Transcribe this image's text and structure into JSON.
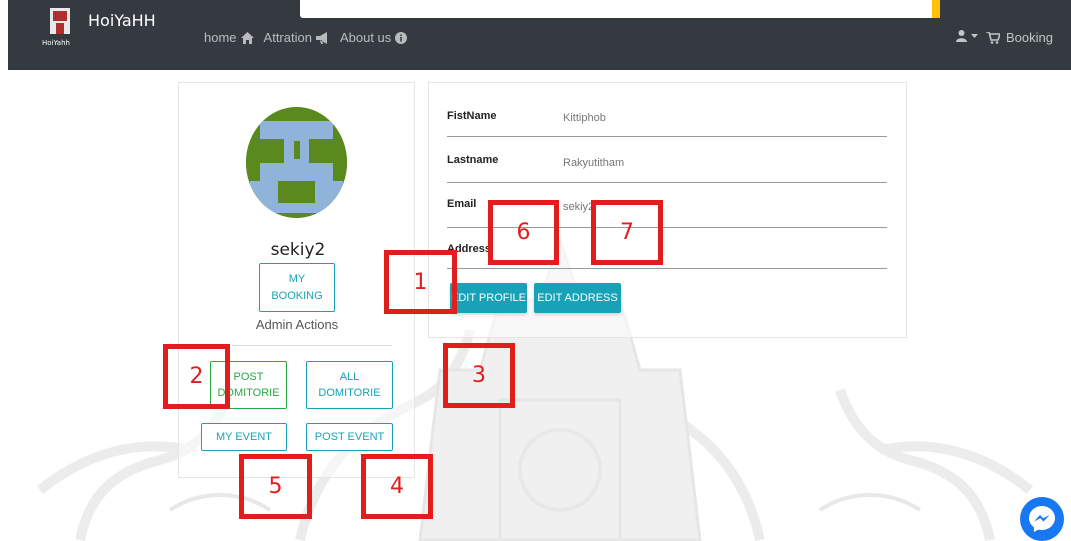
{
  "navbar": {
    "brand_logo_text": "HoiYahh",
    "brand_name": "HoiYaHH",
    "links": [
      {
        "label": "home",
        "icon": "home-icon"
      },
      {
        "label": "Attration",
        "icon": "bullhorn-icon"
      },
      {
        "label": "About us",
        "icon": "info-circle-icon"
      }
    ],
    "user_icon": "user-icon",
    "booking_label": "Booking",
    "booking_icon": "cart-icon",
    "colors": {
      "background": "#343a40",
      "accent": "#ffc107"
    }
  },
  "profile": {
    "username": "sekiy2",
    "my_booking_label": "MY BOOKING",
    "admin_actions_title": "Admin Actions",
    "post_dormitory_label": "POST DOMITORIE",
    "all_dormitory_label": "ALL DOMITORIE",
    "my_event_label": "MY EVENT",
    "post_event_label": "POST EVENT"
  },
  "details": {
    "fields": [
      {
        "label": "FistName",
        "value": "Kittiphob"
      },
      {
        "label": "Lastname",
        "value": "Rakyutitham"
      },
      {
        "label": "Email",
        "value": "sekiy2"
      },
      {
        "label": "Address",
        "value": ""
      }
    ],
    "edit_profile_label": "EDIT PROFILE",
    "edit_address_label": "EDIT ADDRESS"
  },
  "annotations": [
    "1",
    "2",
    "3",
    "4",
    "5",
    "6",
    "7"
  ],
  "colors": {
    "info": "#17a2b8",
    "success": "#28a745",
    "annotation": "#e11d1d",
    "messenger": "#1877f2"
  }
}
